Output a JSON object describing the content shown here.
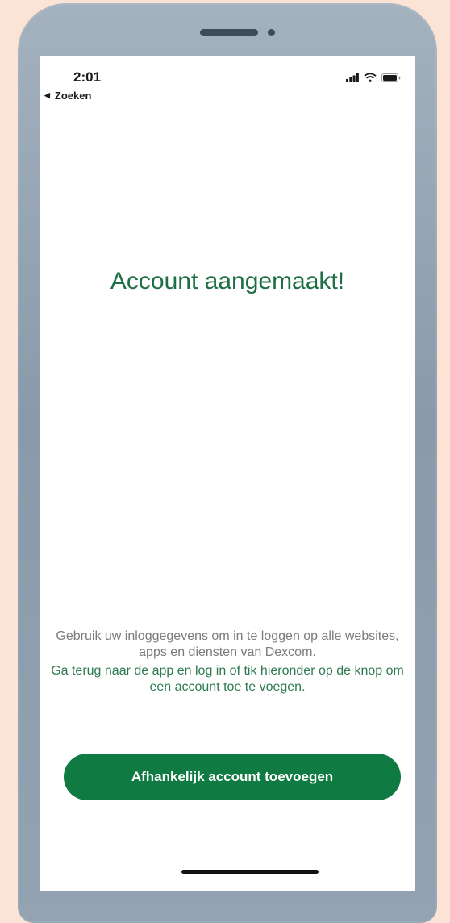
{
  "status_bar": {
    "time": "2:01",
    "back_label": "Zoeken",
    "back_icon": "back-arrow-icon",
    "icons": [
      "cellular-signal-icon",
      "wifi-icon",
      "battery-icon"
    ]
  },
  "main": {
    "title": "Account aangemaakt!",
    "info_text": "Gebruik uw inloggegevens om in te loggen op alle websites, apps en diensten van Dexcom.",
    "instruction_text": "Ga terug naar de app en log in of tik hieronder op de knop om een account toe te voegen.",
    "button_label": "Afhankelijk account toevoegen"
  },
  "colors": {
    "background": "#fbe3d6",
    "title_green": "#1e6f45",
    "button_green": "#0f7a41",
    "info_gray": "#7b7b7b"
  }
}
